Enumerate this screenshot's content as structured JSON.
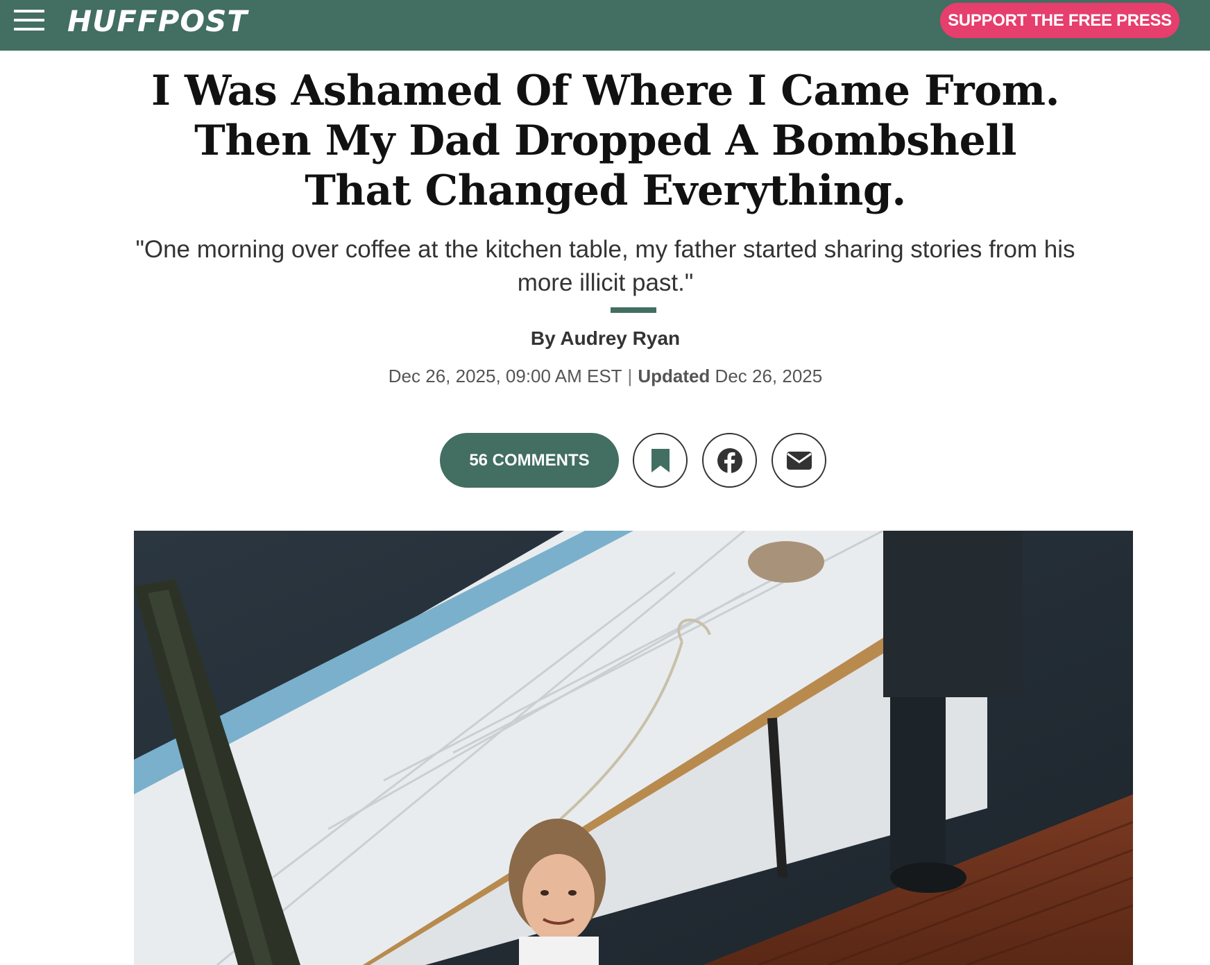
{
  "header": {
    "brand": "HUFFPOST",
    "support_label": "SUPPORT THE FREE PRESS",
    "menu_icon": "hamburger-menu-icon",
    "colors": {
      "bar": "#436e62",
      "support": "#e63e6d"
    }
  },
  "article": {
    "headline": "I Was Ashamed Of Where I Came From. Then My Dad Dropped A Bombshell That Changed Everything.",
    "dek": "\"One morning over coffee at the kitchen table, my father started sharing stories from his more illicit past.\"",
    "byline": "By Audrey Ryan",
    "published": "Dec 26, 2025, 09:00 AM EST",
    "separator": "|",
    "updated_label": "Updated",
    "updated": "Dec 26, 2025"
  },
  "actions": {
    "comments_label": "56 COMMENTS",
    "icons": [
      "bookmark-icon",
      "facebook-icon",
      "email-icon"
    ]
  }
}
